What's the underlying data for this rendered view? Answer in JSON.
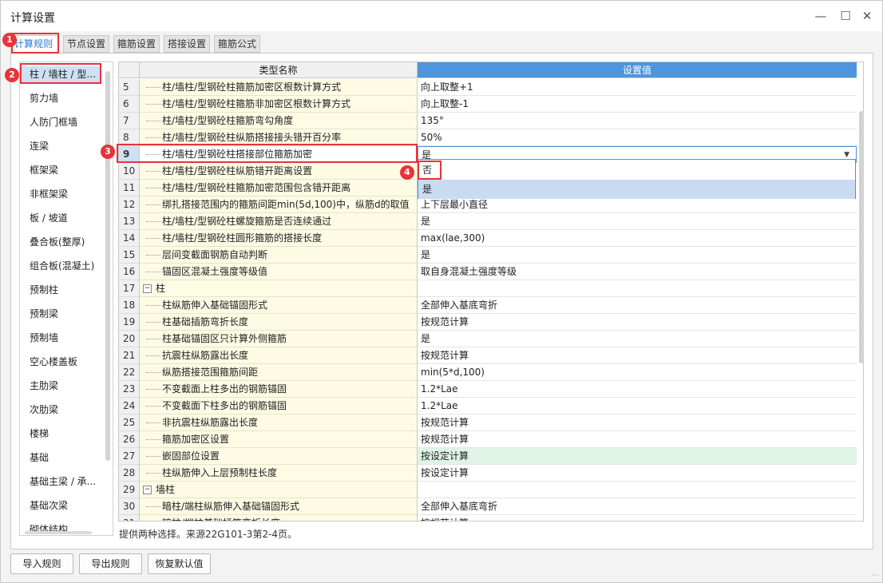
{
  "window": {
    "title": "计算设置"
  },
  "tabs": [
    "计算规则",
    "节点设置",
    "箍筋设置",
    "搭接设置",
    "箍筋公式"
  ],
  "markers": [
    "1",
    "2",
    "3",
    "4"
  ],
  "sidebar": {
    "items": [
      "柱 / 墙柱 / 型...",
      "剪力墙",
      "人防门框墙",
      "连梁",
      "框架梁",
      "非框架梁",
      "板 / 坡道",
      "叠合板(整厚)",
      "组合板(混凝土)",
      "预制柱",
      "预制梁",
      "预制墙",
      "空心楼盖板",
      "主肋梁",
      "次肋梁",
      "楼梯",
      "基础",
      "基础主梁 / 承...",
      "基础次梁",
      "砌体结构"
    ]
  },
  "grid": {
    "headers": {
      "name": "类型名称",
      "value": "设置值"
    },
    "rows": [
      {
        "num": "5",
        "name": "柱/墙柱/型钢砼柱箍筋加密区根数计算方式",
        "value": "向上取整+1"
      },
      {
        "num": "6",
        "name": "柱/墙柱/型钢砼柱箍筋非加密区根数计算方式",
        "value": "向上取整-1"
      },
      {
        "num": "7",
        "name": "柱/墙柱/型钢砼柱箍筋弯勾角度",
        "value": "135°"
      },
      {
        "num": "8",
        "name": "柱/墙柱/型钢砼柱纵筋搭接接头错开百分率",
        "value": "50%"
      },
      {
        "num": "9",
        "name": "柱/墙柱/型钢砼柱搭接部位箍筋加密",
        "value": "是"
      },
      {
        "num": "10",
        "name": "柱/墙柱/型钢砼柱纵筋错开距离设置",
        "value": ""
      },
      {
        "num": "11",
        "name": "柱/墙柱/型钢砼柱箍筋加密范围包含错开距离",
        "value": ""
      },
      {
        "num": "12",
        "name": "绑扎搭接范围内的箍筋间距min(5d,100)中，纵筋d的取值",
        "value": "上下层最小直径"
      },
      {
        "num": "13",
        "name": "柱/墙柱/型钢砼柱螺旋箍筋是否连续通过",
        "value": "是"
      },
      {
        "num": "14",
        "name": "柱/墙柱/型钢砼柱圆形箍筋的搭接长度",
        "value": "max(lae,300)"
      },
      {
        "num": "15",
        "name": "层间变截面钢筋自动判断",
        "value": "是"
      },
      {
        "num": "16",
        "name": "锚固区混凝土强度等级值",
        "value": "取自身混凝土强度等级"
      },
      {
        "num": "17",
        "name": "柱",
        "value": "",
        "group": true
      },
      {
        "num": "18",
        "name": "柱纵筋伸入基础锚固形式",
        "value": "全部伸入基底弯折"
      },
      {
        "num": "19",
        "name": "柱基础插筋弯折长度",
        "value": "按规范计算"
      },
      {
        "num": "20",
        "name": "柱基础锚固区只计算外侧箍筋",
        "value": "是"
      },
      {
        "num": "21",
        "name": "抗震柱纵筋露出长度",
        "value": "按规范计算"
      },
      {
        "num": "22",
        "name": "纵筋搭接范围箍筋间距",
        "value": "min(5*d,100)"
      },
      {
        "num": "23",
        "name": "不变截面上柱多出的钢筋锚固",
        "value": "1.2*Lae"
      },
      {
        "num": "24",
        "name": "不变截面下柱多出的钢筋锚固",
        "value": "1.2*Lae"
      },
      {
        "num": "25",
        "name": "非抗震柱纵筋露出长度",
        "value": "按规范计算"
      },
      {
        "num": "26",
        "name": "箍筋加密区设置",
        "value": "按规范计算"
      },
      {
        "num": "27",
        "name": "嵌固部位设置",
        "value": "按设定计算"
      },
      {
        "num": "28",
        "name": "柱纵筋伸入上层预制柱长度",
        "value": "按设定计算"
      },
      {
        "num": "29",
        "name": "墙柱",
        "value": "",
        "group": true
      },
      {
        "num": "30",
        "name": "暗柱/端柱纵筋伸入基础锚固形式",
        "value": "全部伸入基底弯折"
      },
      {
        "num": "31",
        "name": "暗柱/端柱基础插筋弯折长度",
        "value": "按规范计算"
      }
    ]
  },
  "dropdown": {
    "options": [
      "否",
      "是"
    ]
  },
  "hint": "提供两种选择。来源22G101-3第2-4页。",
  "buttons": {
    "import": "导入规则",
    "export": "导出规则",
    "restore": "恢复默认值"
  },
  "icons": {
    "minimize": "minimize-icon",
    "maximize": "maximize-icon",
    "close": "close-icon"
  },
  "colors": {
    "accent": "#2a7ad3",
    "marker": "#e8333a",
    "name_cell": "#fdfbe4",
    "highlight_row": "#dff3e7"
  }
}
